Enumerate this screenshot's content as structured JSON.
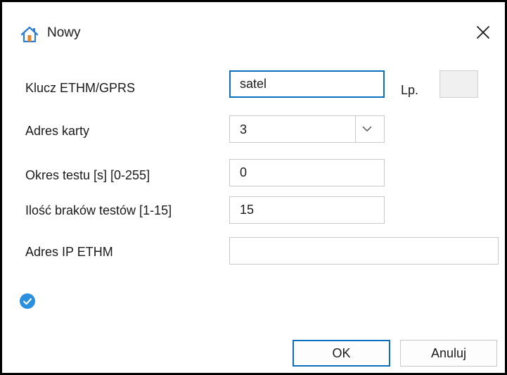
{
  "window": {
    "title": "Nowy",
    "icon": "home-icon",
    "close_icon": "close-icon"
  },
  "form": {
    "key_label": "Klucz ETHM/GPRS",
    "key_value": "satel",
    "lp_label": "Lp.",
    "lp_value": "",
    "card_address_label": "Adres karty",
    "card_address_value": "3",
    "test_period_label": "Okres testu [s] [0-255]",
    "test_period_value": "0",
    "missing_tests_label": "Ilość braków testów [1-15]",
    "missing_tests_value": "15",
    "ip_label": "Adres IP ETHM",
    "ip_value": ""
  },
  "status": {
    "icon": "check-circle-icon"
  },
  "buttons": {
    "ok": "OK",
    "cancel": "Anuluj"
  },
  "colors": {
    "accent": "#0a6fbf",
    "status_check": "#2a8fdf",
    "home_icon_blue": "#2d7dd2",
    "home_icon_orange": "#e8862a"
  }
}
